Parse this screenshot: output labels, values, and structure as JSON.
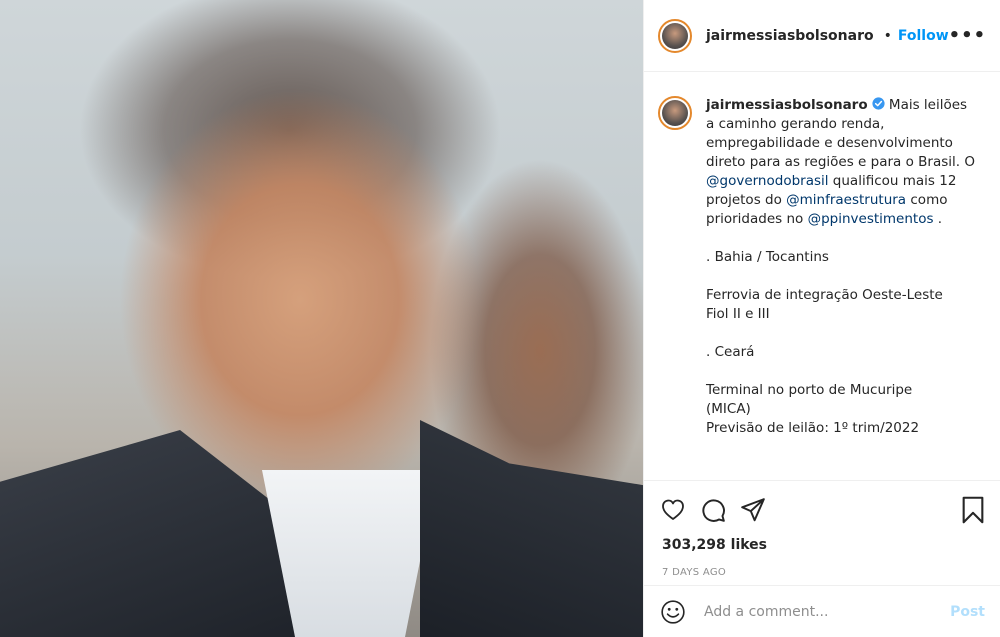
{
  "colors": {
    "follow_blue": "#0095f6",
    "mention_blue": "#00376b",
    "post_disabled": "#b2dffc",
    "avatar_ring": "#e4882c",
    "verified_badge": "#3897f0"
  },
  "header": {
    "username": "jairmessiasbolsonaro",
    "separator": "•",
    "follow_label": "Follow",
    "more_label": "•••"
  },
  "caption": {
    "username": "jairmessiasbolsonaro",
    "text_1": " Mais leilões a caminho gerando renda, empregabilidade e desenvolvimento direto para as regiões e para o Brasil. O ",
    "mention_1": "@governodobrasil",
    "text_2": " qualificou mais 12 projetos do ",
    "mention_2": "@minfraestrutura",
    "text_3": " como prioridades no ",
    "mention_3": "@ppinvestimentos",
    "text_4": " .\n\n. Bahia / Tocantins\n\nFerrovia de integração Oeste-Leste\nFiol II e III\n\n. Ceará\n\nTerminal no porto de Mucuripe\n(MICA)\nPrevisão de leilão: 1º trim/2022"
  },
  "stats": {
    "likes": "303,298 likes",
    "time_ago": "7 DAYS AGO"
  },
  "comment": {
    "placeholder": "Add a comment...",
    "post_label": "Post"
  }
}
